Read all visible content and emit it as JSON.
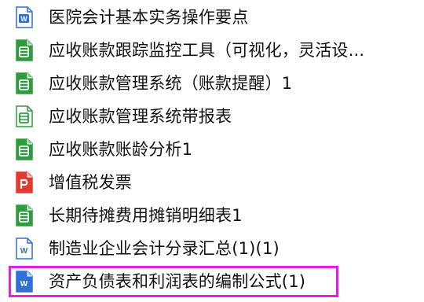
{
  "files": [
    {
      "name": "医院会计基本实务操作要点",
      "icon": "word-doc-icon",
      "color": "#2f6fd6"
    },
    {
      "name": "应收账款跟踪监控工具（可视化，灵活设...",
      "icon": "spreadsheet-icon",
      "color": "#2e9b3e"
    },
    {
      "name": "应收账款管理系统（账款提醒）1",
      "icon": "spreadsheet-icon",
      "color": "#2e9b3e"
    },
    {
      "name": "应收账款管理系统带报表",
      "icon": "spreadsheet-template-icon",
      "color": "#2e9b3e"
    },
    {
      "name": "应收账款账龄分析1",
      "icon": "spreadsheet-icon",
      "color": "#2e9b3e"
    },
    {
      "name": "增值税发票",
      "icon": "pdf-icon",
      "color": "#e23a2e"
    },
    {
      "name": "长期待摊费用摊销明细表1",
      "icon": "spreadsheet-icon",
      "color": "#2e9b3e"
    },
    {
      "name": "制造业企业会计分录汇总(1)(1)",
      "icon": "word-doc-icon",
      "color": "#2f6fd6"
    },
    {
      "name": "资产负债表和利润表的编制公式(1)",
      "icon": "word-doc-icon",
      "color": "#2f6fd6"
    }
  ],
  "highlight_color": "#e41ee8"
}
